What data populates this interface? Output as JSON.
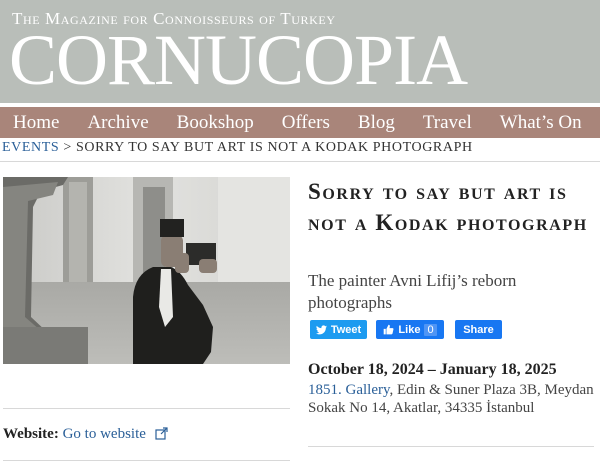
{
  "masthead": {
    "tagline": "The Magazine for Connoisseurs of Turkey",
    "logo": "CORNUCOPIA"
  },
  "nav": {
    "items": [
      {
        "label": "Home"
      },
      {
        "label": "Archive"
      },
      {
        "label": "Bookshop"
      },
      {
        "label": "Offers"
      },
      {
        "label": "Blog"
      },
      {
        "label": "Travel"
      },
      {
        "label": "What’s On"
      }
    ]
  },
  "breadcrumb": {
    "section": "EVENTS",
    "separator": ">",
    "current": "SORRY TO SAY BUT ART IS NOT A KODAK PHOTOGRAPH"
  },
  "article": {
    "title": "Sorry to say but art is not a Kodak photograph",
    "subtitle": "The painter Avni Lifij’s reborn photographs",
    "image_alt": "Black-and-white photograph of a man in a fez holding a camera"
  },
  "share": {
    "tweet_label": "Tweet",
    "like_label": "Like",
    "like_count": "0",
    "share_label": "Share"
  },
  "event": {
    "dates": "October 18, 2024 – January 18, 2025",
    "venue_link": "1851. Gallery",
    "address": ", Edin & Suner Plaza 3B, Meydan Sokak No 14, Akatlar, 34335 İstanbul"
  },
  "website": {
    "label": "Website:",
    "link_text": "Go to website"
  },
  "colors": {
    "masthead_bg": "#b9beb9",
    "nav_bg": "#a9857a",
    "link": "#2a5f98",
    "twitter": "#1d9bf0",
    "facebook": "#1877f2"
  }
}
